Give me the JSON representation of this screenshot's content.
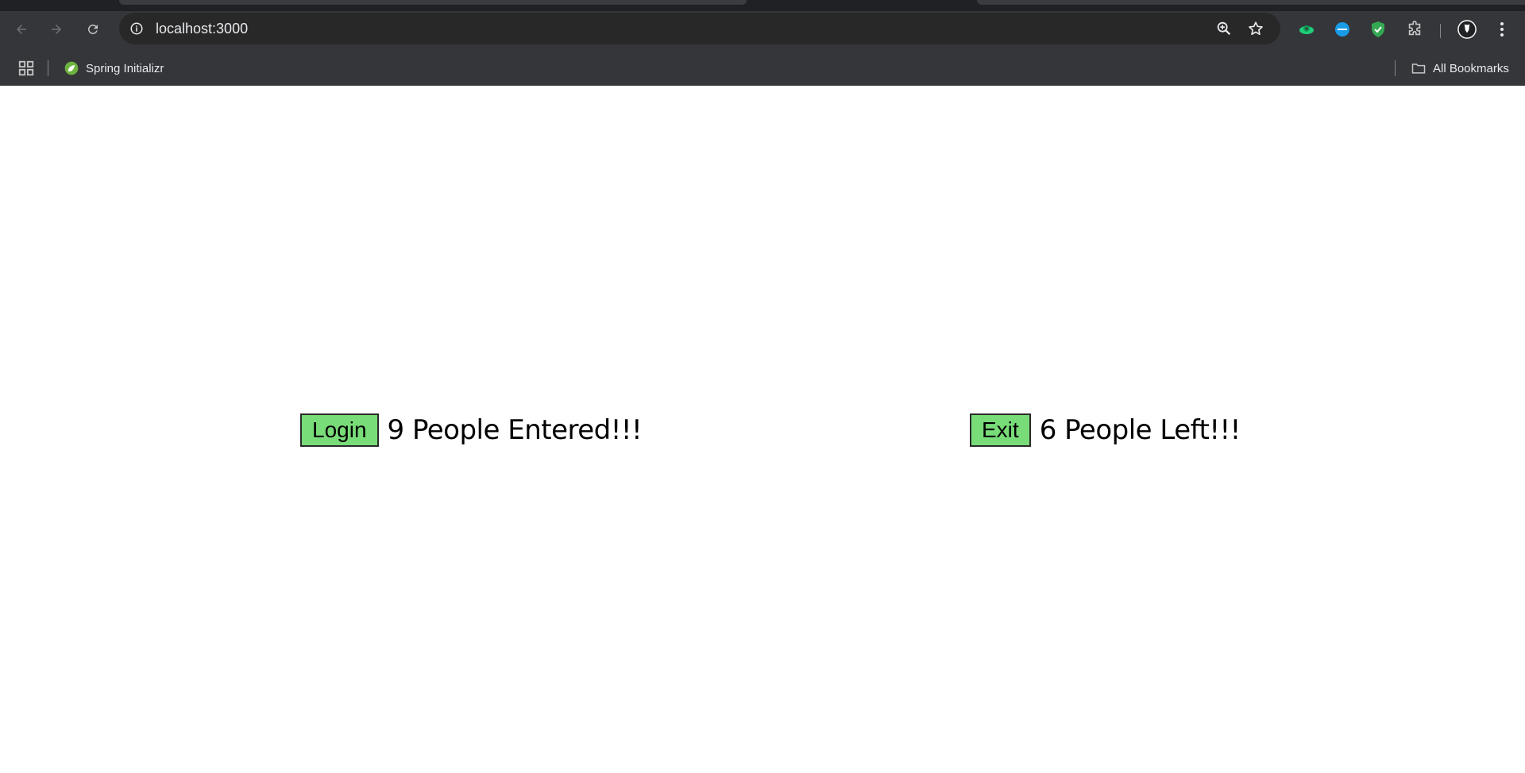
{
  "browser": {
    "url": "localhost:3000",
    "bookmarks_bar": {
      "items": [
        {
          "label": "Spring Initializr",
          "icon": "spring-leaf-icon"
        }
      ],
      "all_bookmarks_label": "All Bookmarks"
    },
    "toolbar_icons": [
      "back-arrow-icon",
      "forward-arrow-icon",
      "reload-icon",
      "site-info-icon",
      "zoom-icon",
      "bookmark-star-icon",
      "extension-green-icon",
      "extension-blue-icon",
      "extension-shield-icon",
      "extensions-puzzle-icon",
      "profile-avatar",
      "menu-kebab-icon"
    ]
  },
  "counters": {
    "entered": {
      "button_label": "Login",
      "text": "9 People Entered!!!",
      "count": 9
    },
    "left": {
      "button_label": "Exit",
      "text": "6 People Left!!!",
      "count": 6
    }
  },
  "colors": {
    "button_bg": "#78dc78",
    "chrome_bg": "#35363a",
    "omnibox_bg": "#282828"
  }
}
